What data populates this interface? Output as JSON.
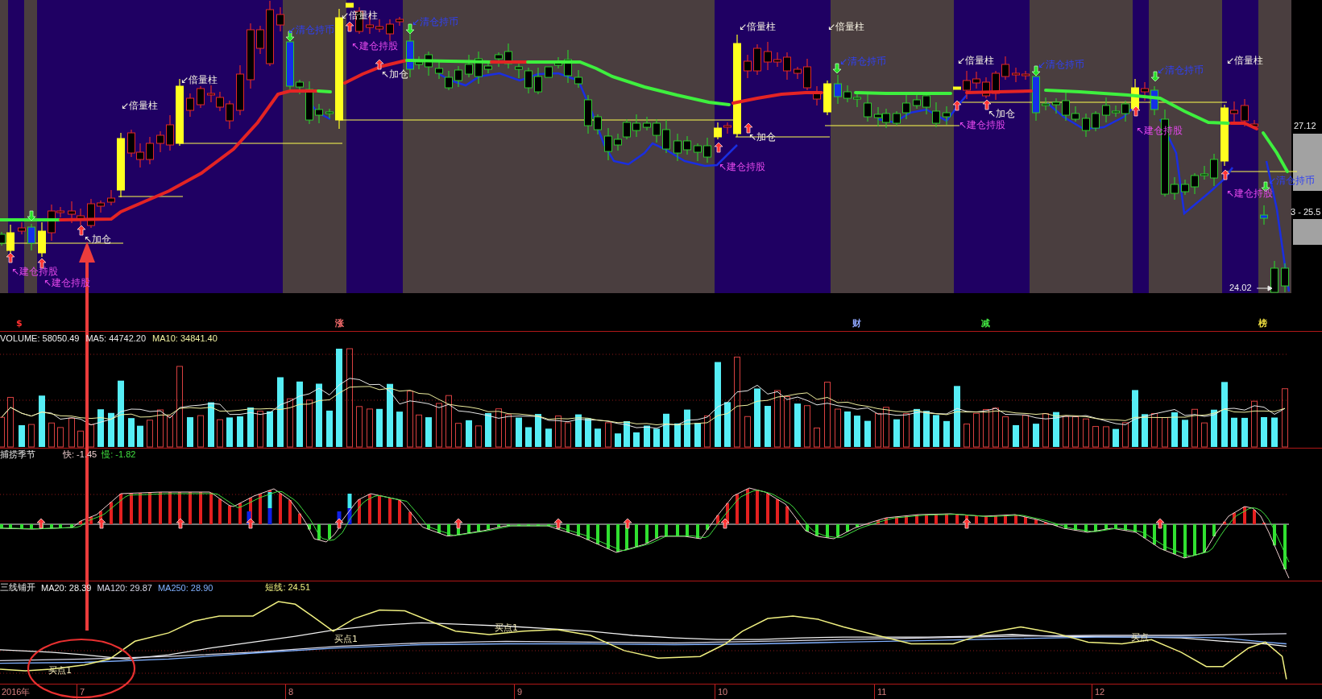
{
  "main_chart": {
    "annotations": [
      {
        "kind": "build",
        "text": "↖建仓持股"
      },
      {
        "kind": "build",
        "text": "↖建仓持股"
      },
      {
        "kind": "add",
        "text": "↖加仓"
      },
      {
        "kind": "double_volume",
        "text": "↙倍量柱"
      },
      {
        "kind": "double_volume",
        "text": "↙倍量柱"
      },
      {
        "kind": "clear",
        "text": "↙清仓持币"
      },
      {
        "kind": "double_volume",
        "text": "↙倍量柱"
      },
      {
        "kind": "build",
        "text": "↖建仓持股"
      },
      {
        "kind": "add",
        "text": "↖加仓"
      },
      {
        "kind": "clear",
        "text": "↙清仓持币"
      },
      {
        "kind": "build",
        "text": "↖建仓持股"
      },
      {
        "kind": "double_volume",
        "text": "↙倍量柱"
      },
      {
        "kind": "add",
        "text": "↖加仓"
      },
      {
        "kind": "double_volume",
        "text": "↙倍量柱"
      },
      {
        "kind": "clear",
        "text": "↙清仓持币"
      },
      {
        "kind": "double_volume",
        "text": "↙倍量柱"
      },
      {
        "kind": "build",
        "text": "↖建仓持股"
      },
      {
        "kind": "add",
        "text": "↖加仓"
      },
      {
        "kind": "clear",
        "text": "↙清仓持币"
      },
      {
        "kind": "build",
        "text": "↖建仓持股"
      },
      {
        "kind": "clear",
        "text": "↙清仓持币"
      },
      {
        "kind": "double_volume",
        "text": "↙倍量柱"
      },
      {
        "kind": "build",
        "text": "↖建仓持股"
      },
      {
        "kind": "clear",
        "text": "↙清仓持币"
      }
    ],
    "last_price": "24.02"
  },
  "price_axis": {
    "labels": [
      "27.12",
      "3 - 25.5"
    ]
  },
  "info_markers": [
    {
      "label": "$",
      "color": "#ff3030"
    },
    {
      "label": "涨",
      "color": "#ff7070"
    },
    {
      "label": "财",
      "color": "#90a8ff"
    },
    {
      "label": "减",
      "color": "#40e040"
    },
    {
      "label": "榜",
      "color": "#f0e040"
    }
  ],
  "volume_panel": {
    "readouts": [
      {
        "text": "VOLUME: 58050.49",
        "color": "#f0f0f0"
      },
      {
        "text": "MA5: 44742.20",
        "color": "#e8e8e8"
      },
      {
        "text": "MA10: 34841.40",
        "color": "#f0f0a0"
      }
    ]
  },
  "indicator_panel": {
    "title": "捕捞季节",
    "readouts": [
      {
        "text": "快: -1.45",
        "color": "#f0d0d0"
      },
      {
        "text": "慢: -1.82",
        "color": "#40e040"
      }
    ]
  },
  "trend_panel": {
    "title": "三线铺开",
    "readouts": [
      {
        "text": "MA20: 28.39",
        "color": "#f0f0f0"
      },
      {
        "text": "MA120: 29.87",
        "color": "#d8d8e8"
      },
      {
        "text": "MA250: 28.90",
        "color": "#80b0ff"
      },
      {
        "text": "短线: 24.51",
        "color": "#f0f080"
      }
    ],
    "signals": [
      "买点1",
      "买点1",
      "买点1",
      "买点"
    ]
  },
  "date_axis": {
    "labels": [
      "2016年",
      "7",
      "8",
      "9",
      "10",
      "11",
      "12"
    ]
  }
}
